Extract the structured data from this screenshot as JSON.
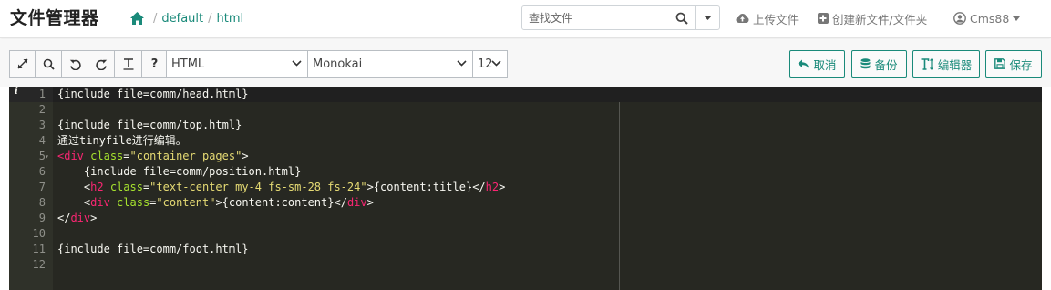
{
  "navbar": {
    "brand": "文件管理器",
    "breadcrumb": [
      "default",
      "html"
    ],
    "search_placeholder": "查找文件",
    "upload_label": "上传文件",
    "create_label": "创建新文件/文件夹",
    "user_label": "Cms88"
  },
  "toolbar": {
    "icons": [
      "fullscreen-icon",
      "search-icon",
      "undo-icon",
      "redo-icon",
      "text-format-icon",
      "help-icon"
    ],
    "help_label": "?",
    "mode_value": "HTML",
    "theme_value": "Monokai",
    "font_size_value": "12",
    "cancel_label": "取消",
    "backup_label": "备份",
    "editor_label": "编辑器",
    "save_label": "保存"
  },
  "editor": {
    "lines": [
      {
        "n": "1",
        "segments": [
          {
            "t": "{include file=comm/head.html}",
            "c": "plain"
          }
        ]
      },
      {
        "n": "2",
        "segments": []
      },
      {
        "n": "3",
        "segments": [
          {
            "t": "{include file=comm/top.html}",
            "c": "plain"
          }
        ]
      },
      {
        "n": "4",
        "segments": [
          {
            "t": "通过tinyfile进行编辑。",
            "c": "plain"
          }
        ]
      },
      {
        "n": "5",
        "segments": [
          {
            "t": "<div",
            "c": "tag"
          },
          {
            "t": " ",
            "c": "plain"
          },
          {
            "t": "class",
            "c": "attr"
          },
          {
            "t": "=",
            "c": "plain"
          },
          {
            "t": "\"container pages\"",
            "c": "str"
          },
          {
            "t": ">",
            "c": "plain"
          }
        ]
      },
      {
        "n": "6",
        "segments": [
          {
            "t": "    {include file=comm/position.html}",
            "c": "plain"
          }
        ]
      },
      {
        "n": "7",
        "segments": [
          {
            "t": "    <",
            "c": "plain"
          },
          {
            "t": "h2",
            "c": "tag"
          },
          {
            "t": " ",
            "c": "plain"
          },
          {
            "t": "class",
            "c": "attr"
          },
          {
            "t": "=",
            "c": "plain"
          },
          {
            "t": "\"text-center my-4 fs-sm-28 fs-24\"",
            "c": "str"
          },
          {
            "t": ">{content:title}</",
            "c": "plain"
          },
          {
            "t": "h2",
            "c": "tag"
          },
          {
            "t": ">",
            "c": "plain"
          }
        ]
      },
      {
        "n": "8",
        "segments": [
          {
            "t": "    <",
            "c": "plain"
          },
          {
            "t": "div",
            "c": "tag"
          },
          {
            "t": " ",
            "c": "plain"
          },
          {
            "t": "class",
            "c": "attr"
          },
          {
            "t": "=",
            "c": "plain"
          },
          {
            "t": "\"content\"",
            "c": "str"
          },
          {
            "t": ">{content:content}</",
            "c": "plain"
          },
          {
            "t": "div",
            "c": "tag"
          },
          {
            "t": ">",
            "c": "plain"
          }
        ]
      },
      {
        "n": "9",
        "segments": [
          {
            "t": "</",
            "c": "plain"
          },
          {
            "t": "div",
            "c": "tag"
          },
          {
            "t": ">",
            "c": "plain"
          }
        ]
      },
      {
        "n": "10",
        "segments": []
      },
      {
        "n": "11",
        "segments": [
          {
            "t": "{include file=comm/foot.html}",
            "c": "plain"
          }
        ]
      },
      {
        "n": "12",
        "segments": []
      }
    ],
    "info_marker": "i",
    "fold_marker": "▾"
  },
  "colors": {
    "accent": "#1a8a7a",
    "editor_bg": "#272822",
    "tag": "#f92672",
    "attr": "#a6e22e",
    "string": "#e6db74"
  }
}
